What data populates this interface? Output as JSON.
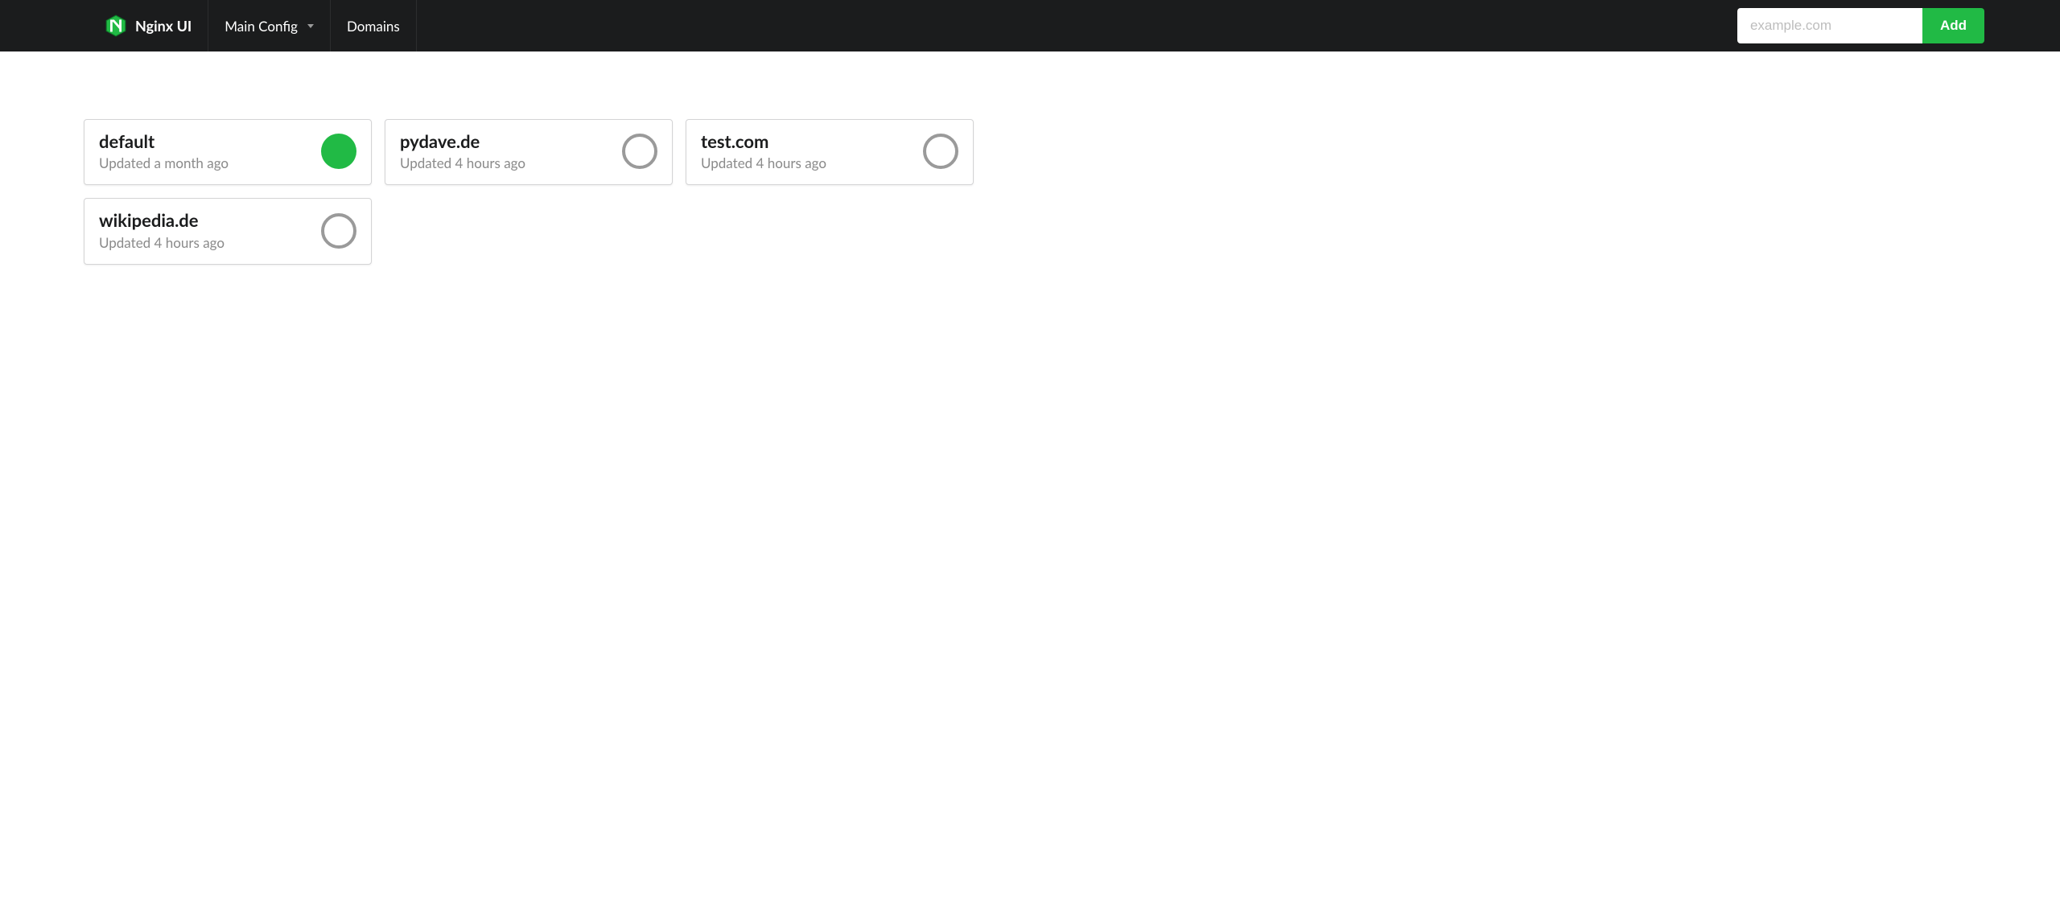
{
  "brand": {
    "name": "Nginx UI"
  },
  "nav": {
    "main_config": "Main Config",
    "domains": "Domains"
  },
  "add_form": {
    "placeholder": "example.com",
    "button": "Add"
  },
  "colors": {
    "accent": "#21ba45",
    "navbar": "#1b1c1d",
    "muted": "#8a8a8a",
    "inactive_ring": "#9a9a9a"
  },
  "domains": [
    {
      "name": "default",
      "updated": "Updated a month ago",
      "active": true
    },
    {
      "name": "pydave.de",
      "updated": "Updated 4 hours ago",
      "active": false
    },
    {
      "name": "test.com",
      "updated": "Updated 4 hours ago",
      "active": false
    },
    {
      "name": "wikipedia.de",
      "updated": "Updated 4 hours ago",
      "active": false
    }
  ]
}
